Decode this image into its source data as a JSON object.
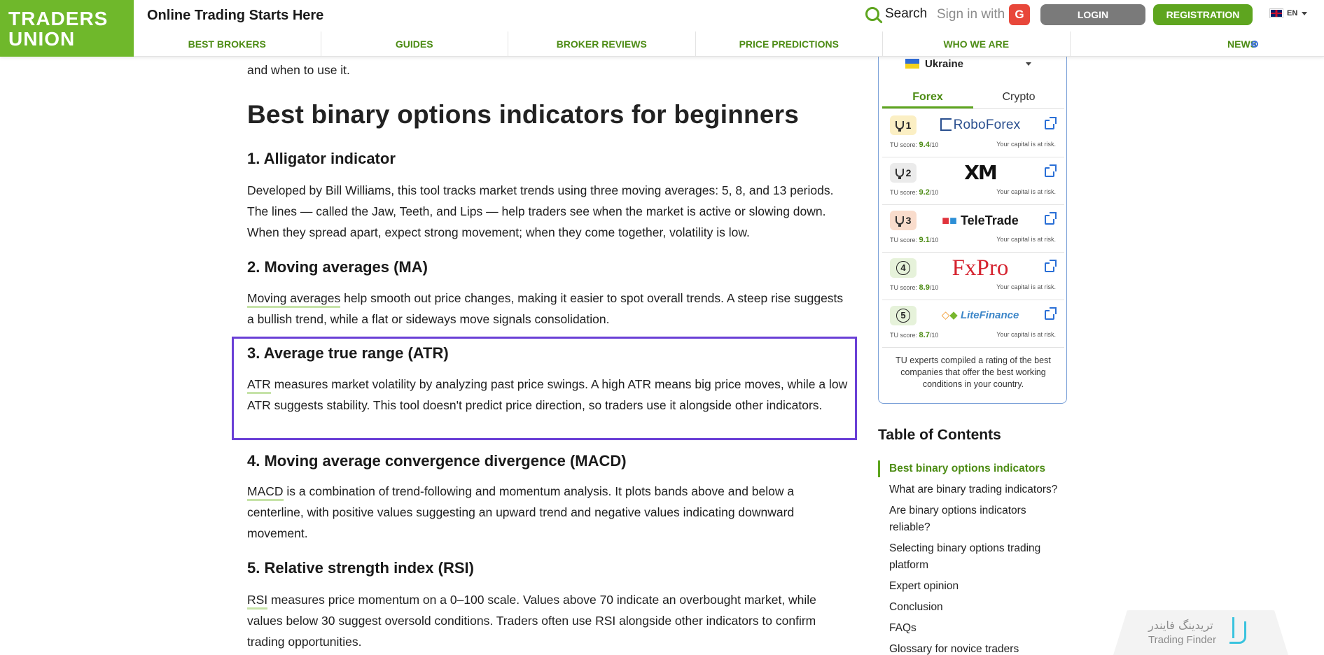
{
  "header": {
    "logo_line1": "TRADERS",
    "logo_line2": "UNION",
    "tagline": "Online Trading Starts Here",
    "search_label": "Search",
    "signin_label": "Sign in with",
    "google_letter": "G",
    "login_label": "LOGIN",
    "registration_label": "REGISTRATION",
    "language": "EN"
  },
  "nav": {
    "items": [
      "BEST BROKERS",
      "GUIDES",
      "BROKER REVIEWS",
      "PRICE PREDICTIONS",
      "WHO WE ARE",
      "NEWS"
    ]
  },
  "article": {
    "intro_tail": "and when to use it.",
    "heading": "Best binary options indicators for beginners",
    "sections": [
      {
        "title": "1. Alligator indicator",
        "body": "Developed by Bill Williams, this tool tracks market trends using three moving averages: 5, 8, and 13 periods. The lines — called the Jaw, Teeth, and Lips — help traders see when the market is active or slowing down. When they spread apart, expect strong movement; when they come together, volatility is low."
      },
      {
        "title": "2. Moving averages (MA)",
        "link": "Moving averages",
        "body": " help smooth out price changes, making it easier to spot overall trends. A steep rise suggests a bullish trend, while a flat or sideways move signals consolidation."
      },
      {
        "title": "3. Average true range (ATR)",
        "link": "ATR",
        "body": " measures market volatility by analyzing past price swings. A high ATR means big price moves, while a low ATR suggests stability. This tool doesn't predict price direction, so traders use it alongside other indicators."
      },
      {
        "title": "4. Moving average convergence divergence (MACD)",
        "link": "MACD",
        "body": " is a combination of trend-following and momentum analysis. It plots bands above and below a centerline, with positive values suggesting an upward trend and negative values indicating downward movement."
      },
      {
        "title": "5. Relative strength index (RSI)",
        "link": "RSI",
        "body": " measures price momentum on a 0–100 scale. Values above 70 indicate an overbought market, while values below 30 suggest oversold conditions. Traders often use RSI alongside other indicators to confirm trading opportunities."
      }
    ]
  },
  "widget": {
    "country": "Ukraine",
    "tabs": [
      "Forex",
      "Crypto"
    ],
    "score_prefix": "TU score:",
    "score_suffix": "/10",
    "risk_text": "Your capital is at risk.",
    "brokers": [
      {
        "rank": "1",
        "score": "9.4",
        "name": "RoboForex"
      },
      {
        "rank": "2",
        "score": "9.2",
        "name": "XM"
      },
      {
        "rank": "3",
        "score": "9.1",
        "name": "TeleTrade"
      },
      {
        "rank": "4",
        "score": "8.9",
        "name": "FxPro"
      },
      {
        "rank": "5",
        "score": "8.7",
        "name": "LiteFinance"
      }
    ],
    "note": "TU experts compiled a rating of the best companies that offer the best working conditions in your country."
  },
  "toc": {
    "title": "Table of Contents",
    "items": [
      "Best binary options indicators",
      "What are binary trading indicators?",
      "Are binary options indicators reliable?",
      "Selecting binary options trading platform",
      "Expert opinion",
      "Conclusion",
      "FAQs",
      "Glossary for novice traders"
    ]
  },
  "watermark": {
    "text_fa": "تریدینگ فایندر",
    "text_en": "Trading Finder"
  },
  "colors": {
    "brand_green": "#6fb82b",
    "link_green": "#4d8c15",
    "highlight_purple": "#6a3fd6"
  }
}
